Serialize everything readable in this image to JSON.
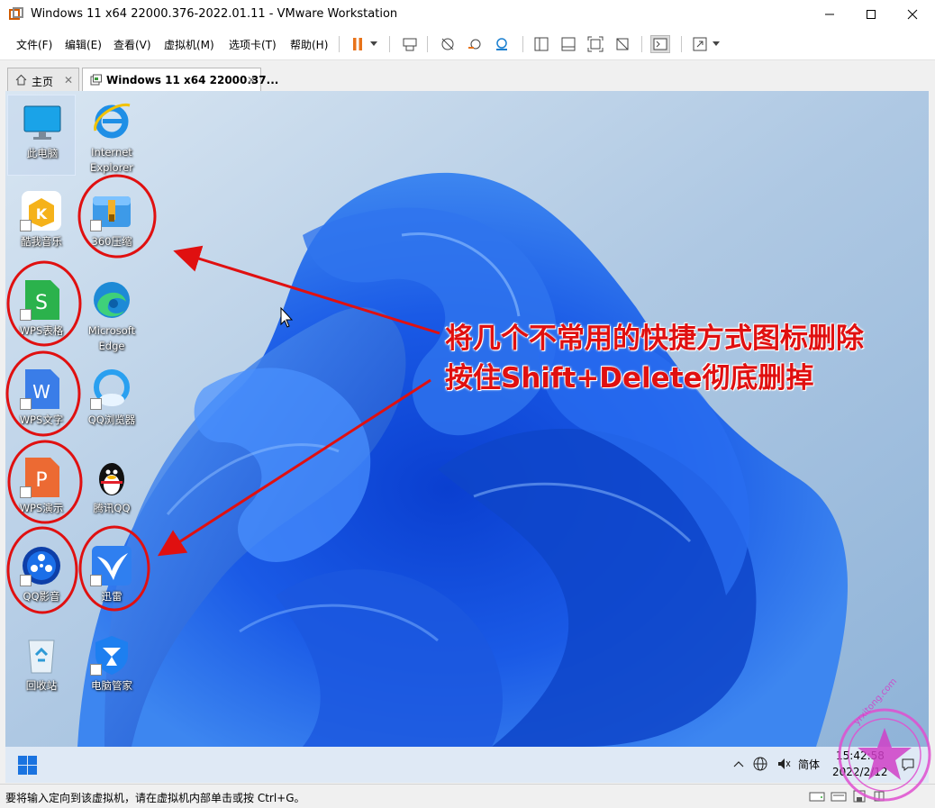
{
  "window": {
    "title": "Windows 11 x64 22000.376-2022.01.11 - VMware Workstation",
    "controls": [
      "minimize",
      "maximize",
      "close"
    ]
  },
  "menu": {
    "items": [
      "文件(F)",
      "编辑(E)",
      "查看(V)",
      "虚拟机(M)",
      "选项卡(T)",
      "帮助(H)"
    ]
  },
  "tabs": [
    {
      "label": "主页"
    },
    {
      "label": "Windows 11 x64 22000.37..."
    }
  ],
  "desktop": {
    "icons": [
      {
        "label": "此电脑",
        "icon": "computer-icon",
        "selected": true
      },
      {
        "label": "Internet Explorer",
        "icon": "internet-explorer-icon"
      },
      {
        "label": "酷我音乐",
        "icon": "kuwo-music-icon"
      },
      {
        "label": "360压缩",
        "icon": "360-zip-icon"
      },
      {
        "label": "WPS表格",
        "icon": "wps-spreadsheet-icon"
      },
      {
        "label": "Microsoft Edge",
        "icon": "edge-icon"
      },
      {
        "label": "WPS文字",
        "icon": "wps-writer-icon"
      },
      {
        "label": "QQ浏览器",
        "icon": "qq-browser-icon"
      },
      {
        "label": "WPS演示",
        "icon": "wps-presentation-icon"
      },
      {
        "label": "腾讯QQ",
        "icon": "qq-icon"
      },
      {
        "label": "QQ影音",
        "icon": "qq-player-icon"
      },
      {
        "label": "迅雷",
        "icon": "xunlei-icon"
      },
      {
        "label": "回收站",
        "icon": "recycle-bin-icon"
      },
      {
        "label": "电脑管家",
        "icon": "pc-manager-icon"
      }
    ]
  },
  "annotation": {
    "line1": "将几个不常用的快捷方式图标删除",
    "line2": "按住Shift+Delete彻底删掉",
    "color": "#e01010"
  },
  "taskbar": {
    "ime": "简体",
    "time": "15:42:58",
    "date": "2022/2/12"
  },
  "statusbar": {
    "message": "要将输入定向到该虚拟机，请在虚拟机内部单击或按 Ctrl+G。"
  },
  "watermark": {
    "text": "yrxitong.com"
  }
}
